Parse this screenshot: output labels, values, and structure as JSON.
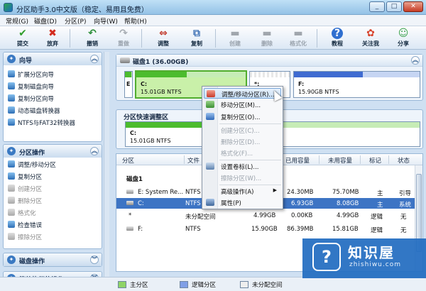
{
  "window": {
    "title": "分区助手3.0中文版（稳定、易用且免费）",
    "minimize": "_",
    "maximize": "□",
    "close": "✕"
  },
  "menu": [
    "常规(G)",
    "磁盘(D)",
    "分区(P)",
    "向导(W)",
    "帮助(H)"
  ],
  "toolbar": {
    "commit": "提交",
    "discard": "放弃",
    "undo": "撤销",
    "redo": "重做",
    "resize": "调整",
    "copy": "复制",
    "create": "创建",
    "delete": "删除",
    "format": "格式化",
    "tutorial": "教程",
    "follow": "关注我",
    "share": "分享"
  },
  "sidebar": {
    "wizard": {
      "title": "向导",
      "items": [
        "扩展分区向导",
        "复制磁盘向导",
        "复制分区向导",
        "动态磁盘转换器",
        "NTFS与FAT32转换器"
      ]
    },
    "partition_ops": {
      "title": "分区操作",
      "items": [
        "调整/移动分区",
        "复制分区",
        "创建分区",
        "删除分区",
        "格式化",
        "检查错误",
        "擦除分区"
      ]
    },
    "disk_ops": {
      "title": "磁盘操作"
    },
    "pending_ops": {
      "title": "等待执行的操作"
    },
    "collapse": "︽",
    "expand": "︾"
  },
  "disk_map": {
    "title": "磁盘1 (36.00GB)",
    "partitions": [
      {
        "label": "E",
        "detail": "",
        "fill": 0.9
      },
      {
        "label": "C:",
        "detail": "15.01GB NTFS",
        "fill": 0.46
      },
      {
        "label": "*:",
        "detail": "",
        "fill": 0
      },
      {
        "label": "F:",
        "detail": "15.90GB NTFS",
        "fill": 0.55
      }
    ]
  },
  "quick_resize": {
    "title": "分区快速调整区",
    "partition": {
      "label": "C:",
      "detail": "15.01GB NTFS",
      "fill": 0.46
    }
  },
  "table": {
    "columns": [
      "分区",
      "文件",
      "容量",
      "已用容量",
      "未用容量",
      "标记",
      "状态"
    ],
    "disk_label": "磁盘1",
    "rows": [
      {
        "partition": "E:  System Re...",
        "fs": "NTFS",
        "capacity": "",
        "used": "24.30MB",
        "unused": "75.70MB",
        "flag": "主",
        "status": "引导"
      },
      {
        "partition": "C:",
        "fs": "NTFS",
        "capacity": "",
        "used": "6.93GB",
        "unused": "8.08GB",
        "flag": "主",
        "status": "系统"
      },
      {
        "partition": "*",
        "fs": "未分配空间",
        "capacity": "4.99GB",
        "used": "0.00KB",
        "unused": "4.99GB",
        "flag": "逻辑",
        "status": "无"
      },
      {
        "partition": "F:",
        "fs": "NTFS",
        "capacity": "15.90GB",
        "used": "86.39MB",
        "unused": "15.81GB",
        "flag": "逻辑",
        "status": "无"
      }
    ]
  },
  "context_menu": {
    "items": [
      {
        "label": "调整/移动分区(R)...",
        "enabled": true,
        "highlighted": true
      },
      {
        "label": "移动分区(M)...",
        "enabled": true
      },
      {
        "label": "复制分区(O)...",
        "enabled": true
      },
      {
        "label": "创建分区(C)...",
        "enabled": false
      },
      {
        "label": "删除分区(D)...",
        "enabled": false
      },
      {
        "label": "格式化(F)...",
        "enabled": false
      },
      {
        "label": "设置卷标(L)...",
        "enabled": true
      },
      {
        "label": "擦除分区(W)...",
        "enabled": false
      },
      {
        "label": "高级操作(A)",
        "enabled": true,
        "submenu": "▶"
      },
      {
        "label": "属性(P)",
        "enabled": true
      }
    ]
  },
  "legend": {
    "primary": "主分区",
    "logical": "逻辑分区",
    "unallocated": "未分配空间"
  },
  "watermark": {
    "name": "知识屋",
    "url": "zhishiwu.com"
  },
  "colors": {
    "primary": "#4cbc2e",
    "logical": "#3f6bd1",
    "selection": "#3d74c4",
    "accent": "#2a6fc0"
  }
}
